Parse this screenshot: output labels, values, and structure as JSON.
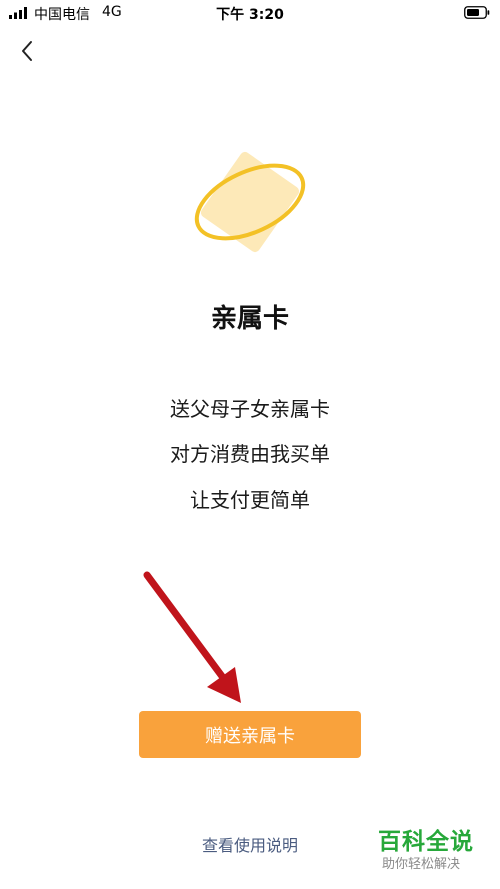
{
  "status_bar": {
    "carrier": "中国电信",
    "network": "4G",
    "time": "下午 3:20"
  },
  "icons": {
    "back": "chevron-left-icon",
    "card": "card-ring-icon"
  },
  "colors": {
    "accent": "#f9a23c",
    "card_fill": "#fde9b8",
    "ring": "#f3c126",
    "arrow": "#c0141b",
    "link": "#4b5c80",
    "watermark": "#27a83a"
  },
  "main": {
    "title": "亲属卡",
    "description": [
      "送父母子女亲属卡",
      "对方消费由我买单",
      "让支付更简单"
    ],
    "primary_button": "赠送亲属卡",
    "help_link": "查看使用说明"
  },
  "watermark": {
    "brand": "百科全说",
    "slogan": "助你轻松解决"
  }
}
